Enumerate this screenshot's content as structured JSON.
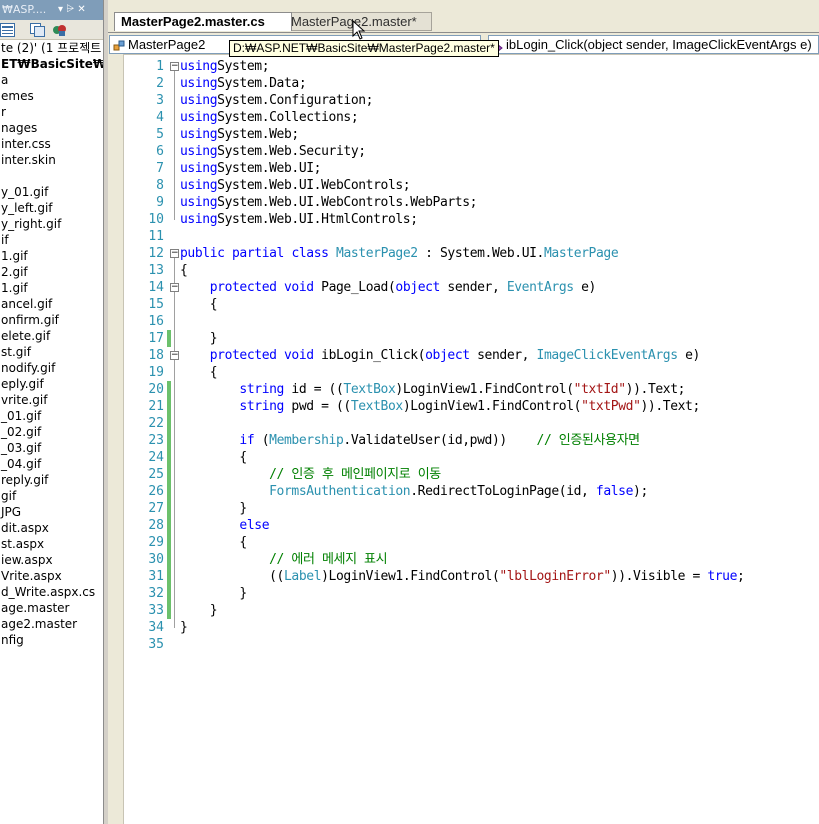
{
  "solution_explorer": {
    "title": "₩ASP....",
    "pin_glyph": "▾ ⩥ ✕",
    "items": [
      {
        "label": "te (2)' (1 프로젝트",
        "bold": false
      },
      {
        "label": "ET₩BasicSite₩",
        "bold": true
      },
      {
        "label": "a",
        "bold": false
      },
      {
        "label": "emes",
        "bold": false
      },
      {
        "label": "r",
        "bold": false
      },
      {
        "label": "nages",
        "bold": false
      },
      {
        "label": "inter.css",
        "bold": false
      },
      {
        "label": "inter.skin",
        "bold": false
      },
      {
        "label": "",
        "bold": false
      },
      {
        "label": "y_01.gif",
        "bold": false
      },
      {
        "label": "y_left.gif",
        "bold": false
      },
      {
        "label": "y_right.gif",
        "bold": false
      },
      {
        "label": "if",
        "bold": false
      },
      {
        "label": "1.gif",
        "bold": false
      },
      {
        "label": "2.gif",
        "bold": false
      },
      {
        "label": "1.gif",
        "bold": false
      },
      {
        "label": "ancel.gif",
        "bold": false
      },
      {
        "label": "onfirm.gif",
        "bold": false
      },
      {
        "label": "elete.gif",
        "bold": false
      },
      {
        "label": "st.gif",
        "bold": false
      },
      {
        "label": "nodify.gif",
        "bold": false
      },
      {
        "label": "eply.gif",
        "bold": false
      },
      {
        "label": "vrite.gif",
        "bold": false
      },
      {
        "label": "_01.gif",
        "bold": false
      },
      {
        "label": "_02.gif",
        "bold": false
      },
      {
        "label": "_03.gif",
        "bold": false
      },
      {
        "label": "_04.gif",
        "bold": false
      },
      {
        "label": "reply.gif",
        "bold": false
      },
      {
        "label": "gif",
        "bold": false
      },
      {
        "label": "JPG",
        "bold": false
      },
      {
        "label": "dit.aspx",
        "bold": false
      },
      {
        "label": "st.aspx",
        "bold": false
      },
      {
        "label": "iew.aspx",
        "bold": false
      },
      {
        "label": "Vrite.aspx",
        "bold": false
      },
      {
        "label": "d_Write.aspx.cs",
        "bold": false
      },
      {
        "label": "age.master",
        "bold": false
      },
      {
        "label": "age2.master",
        "bold": false
      },
      {
        "label": "nfig",
        "bold": false
      }
    ]
  },
  "tabs": [
    {
      "label": "MasterPage2.master.cs",
      "active": true
    },
    {
      "label": "MasterPage2.master*",
      "active": false
    }
  ],
  "navbar": {
    "class_combo": "MasterPage2",
    "method_combo": "ibLogin_Click(object sender, ImageClickEventArgs e)",
    "path_tooltip": "D:₩ASP.NET₩BasicSite₩MasterPage2.master*"
  },
  "editor": {
    "line_numbers": [
      "1",
      "2",
      "3",
      "4",
      "5",
      "6",
      "7",
      "8",
      "9",
      "10",
      "11",
      "12",
      "13",
      "14",
      "15",
      "16",
      "17",
      "18",
      "19",
      "20",
      "21",
      "22",
      "23",
      "24",
      "25",
      "26",
      "27",
      "28",
      "29",
      "30",
      "31",
      "32",
      "33",
      "34",
      "35"
    ],
    "lines": [
      [
        [
          "kw",
          "using"
        ],
        [
          "",
          "System;"
        ]
      ],
      [
        [
          "kw",
          "using"
        ],
        [
          "",
          "System.Data;"
        ]
      ],
      [
        [
          "kw",
          "using"
        ],
        [
          "",
          "System.Configuration;"
        ]
      ],
      [
        [
          "kw",
          "using"
        ],
        [
          "",
          "System.Collections;"
        ]
      ],
      [
        [
          "kw",
          "using"
        ],
        [
          "",
          "System.Web;"
        ]
      ],
      [
        [
          "kw",
          "using"
        ],
        [
          "",
          "System.Web.Security;"
        ]
      ],
      [
        [
          "kw",
          "using"
        ],
        [
          "",
          "System.Web.UI;"
        ]
      ],
      [
        [
          "kw",
          "using"
        ],
        [
          "",
          "System.Web.UI.WebControls;"
        ]
      ],
      [
        [
          "kw",
          "using"
        ],
        [
          "",
          "System.Web.UI.WebControls.WebParts;"
        ]
      ],
      [
        [
          "kw",
          "using"
        ],
        [
          "",
          "System.Web.UI.HtmlControls;"
        ]
      ],
      [],
      [
        [
          "kw",
          "public"
        ],
        [
          "",
          " "
        ],
        [
          "kw",
          "partial"
        ],
        [
          "",
          " "
        ],
        [
          "kw",
          "class"
        ],
        [
          "",
          " "
        ],
        [
          "ty",
          "MasterPage2"
        ],
        [
          "",
          " : System.Web.UI."
        ],
        [
          "ty",
          "MasterPage"
        ]
      ],
      [
        [
          "",
          "{"
        ]
      ],
      [
        [
          "",
          "    "
        ],
        [
          "kw",
          "protected"
        ],
        [
          "",
          " "
        ],
        [
          "kw",
          "void"
        ],
        [
          "",
          " Page_Load("
        ],
        [
          "kw",
          "object"
        ],
        [
          "",
          " sender, "
        ],
        [
          "ty",
          "EventArgs"
        ],
        [
          "",
          " e)"
        ]
      ],
      [
        [
          "",
          "    {"
        ]
      ],
      [],
      [
        [
          "",
          "    }"
        ]
      ],
      [
        [
          "",
          "    "
        ],
        [
          "kw",
          "protected"
        ],
        [
          "",
          " "
        ],
        [
          "kw",
          "void"
        ],
        [
          "",
          " ibLogin_Click("
        ],
        [
          "kw",
          "object"
        ],
        [
          "",
          " sender, "
        ],
        [
          "ty",
          "ImageClickEventArgs"
        ],
        [
          "",
          " e)"
        ]
      ],
      [
        [
          "",
          "    {"
        ]
      ],
      [
        [
          "",
          "        "
        ],
        [
          "kw",
          "string"
        ],
        [
          "",
          " id = (("
        ],
        [
          "ty",
          "TextBox"
        ],
        [
          "",
          ")LoginView1.FindControl("
        ],
        [
          "st",
          "\"txtId\""
        ],
        [
          "",
          "))."
        ],
        [
          "",
          "Text;"
        ]
      ],
      [
        [
          "",
          "        "
        ],
        [
          "kw",
          "string"
        ],
        [
          "",
          " pwd = (("
        ],
        [
          "ty",
          "TextBox"
        ],
        [
          "",
          ")LoginView1.FindControl("
        ],
        [
          "st",
          "\"txtPwd\""
        ],
        [
          "",
          ")).Text;"
        ]
      ],
      [],
      [
        [
          "",
          "        "
        ],
        [
          "kw",
          "if"
        ],
        [
          "",
          " ("
        ],
        [
          "ty",
          "Membership"
        ],
        [
          "",
          ".ValidateUser(id,pwd))    "
        ],
        [
          "cm",
          "// 인증된사용자면"
        ]
      ],
      [
        [
          "",
          "        {"
        ]
      ],
      [
        [
          "",
          "            "
        ],
        [
          "cm",
          "// 인증 후 메인페이지로 이동"
        ]
      ],
      [
        [
          "",
          "            "
        ],
        [
          "ty",
          "FormsAuthentication"
        ],
        [
          "",
          ".RedirectToLoginPage(id, "
        ],
        [
          "kw",
          "false"
        ],
        [
          "",
          ");"
        ]
      ],
      [
        [
          "",
          "        }"
        ]
      ],
      [
        [
          "",
          "        "
        ],
        [
          "kw",
          "else"
        ]
      ],
      [
        [
          "",
          "        {"
        ]
      ],
      [
        [
          "",
          "            "
        ],
        [
          "cm",
          "// 에러 메세지 표시"
        ]
      ],
      [
        [
          "",
          "            (("
        ],
        [
          "ty",
          "Label"
        ],
        [
          "",
          ")LoginView1.FindControl("
        ],
        [
          "st",
          "\"lblLoginError\""
        ],
        [
          "",
          ")).Visible = "
        ],
        [
          "kw",
          "true"
        ],
        [
          "",
          ";"
        ]
      ],
      [
        [
          "",
          "        }"
        ]
      ],
      [
        [
          "",
          "    }"
        ]
      ],
      [
        [
          "",
          "}"
        ]
      ],
      []
    ]
  }
}
